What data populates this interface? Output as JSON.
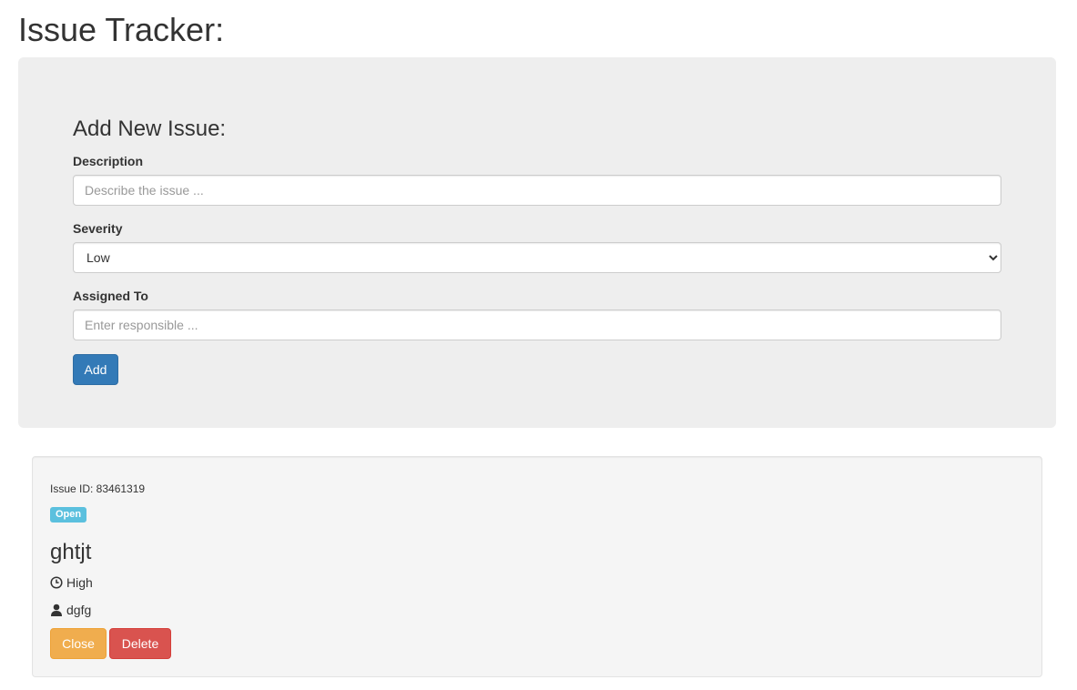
{
  "page": {
    "title": "Issue Tracker:"
  },
  "form": {
    "heading": "Add New Issue:",
    "description": {
      "label": "Description",
      "placeholder": "Describe the issue ...",
      "value": ""
    },
    "severity": {
      "label": "Severity",
      "selected": "Low"
    },
    "assigned_to": {
      "label": "Assigned To",
      "placeholder": "Enter responsible ...",
      "value": ""
    },
    "add_button_label": "Add"
  },
  "issues": [
    {
      "id_text": "Issue ID: 83461319",
      "status": "Open",
      "description": "ghtjt",
      "severity": "High",
      "severity_icon": "clock-icon",
      "assignee": "dgfg",
      "assignee_icon": "user-icon",
      "close_label": "Close",
      "delete_label": "Delete"
    }
  ],
  "colors": {
    "primary": "#337ab7",
    "warning": "#f0ad4e",
    "danger": "#d9534f",
    "info": "#5bc0de",
    "jumbotron_bg": "#eeeeee",
    "well_bg": "#f5f5f5"
  }
}
